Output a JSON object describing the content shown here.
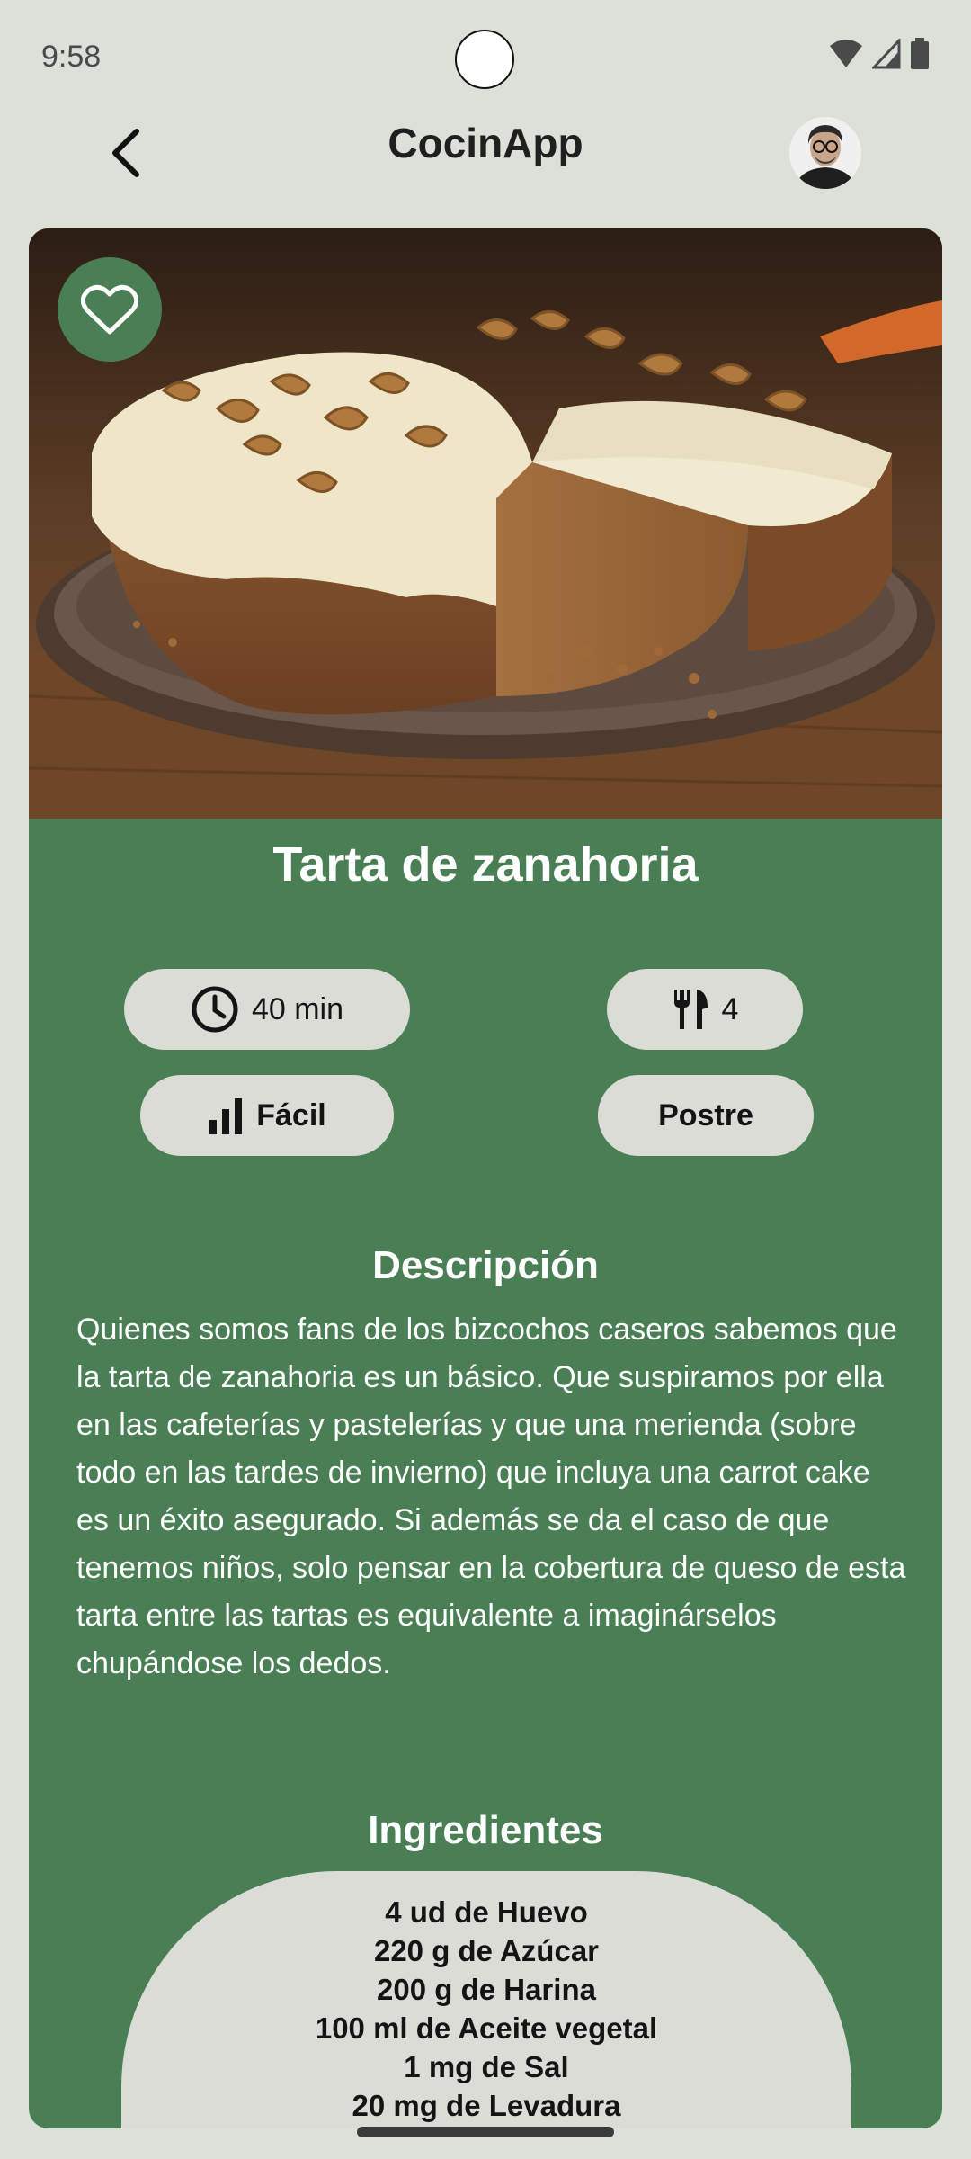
{
  "status_bar": {
    "time": "9:58"
  },
  "app_bar": {
    "title": "CocinApp"
  },
  "recipe": {
    "title": "Tarta de zanahoria",
    "time": "40 min",
    "servings": "4",
    "difficulty": "Fácil",
    "category": "Postre",
    "description_title": "Descripción",
    "description": "Quienes somos fans de los bizcochos caseros sabemos que la tarta de zanahoria es un básico. Que suspiramos por ella en las cafeterías y pastelerías y que una merienda (sobre todo en las tardes de invierno) que incluya una carrot cake es un éxito asegurado. Si además se da el caso de que tenemos niños, solo pensar en la cobertura de queso de esta tarta entre las tartas es equivalente a imaginárselos chupándose los dedos.",
    "ingredients_title": "Ingredientes",
    "ingredients": [
      "4 ud de Huevo",
      "220 g de Azúcar",
      "200 g de Harina",
      "100 ml de Aceite vegetal",
      "1 mg de Sal",
      "20 mg de Levadura"
    ]
  },
  "icons": {
    "back": "arrow-back-icon",
    "favorite": "heart-outline-icon",
    "time": "clock-icon",
    "servings": "fork-knife-icon",
    "difficulty": "bar-chart-icon"
  },
  "colors": {
    "background": "#dbe1d9",
    "card": "#4a7f55",
    "chip": "#dcdcd7"
  }
}
